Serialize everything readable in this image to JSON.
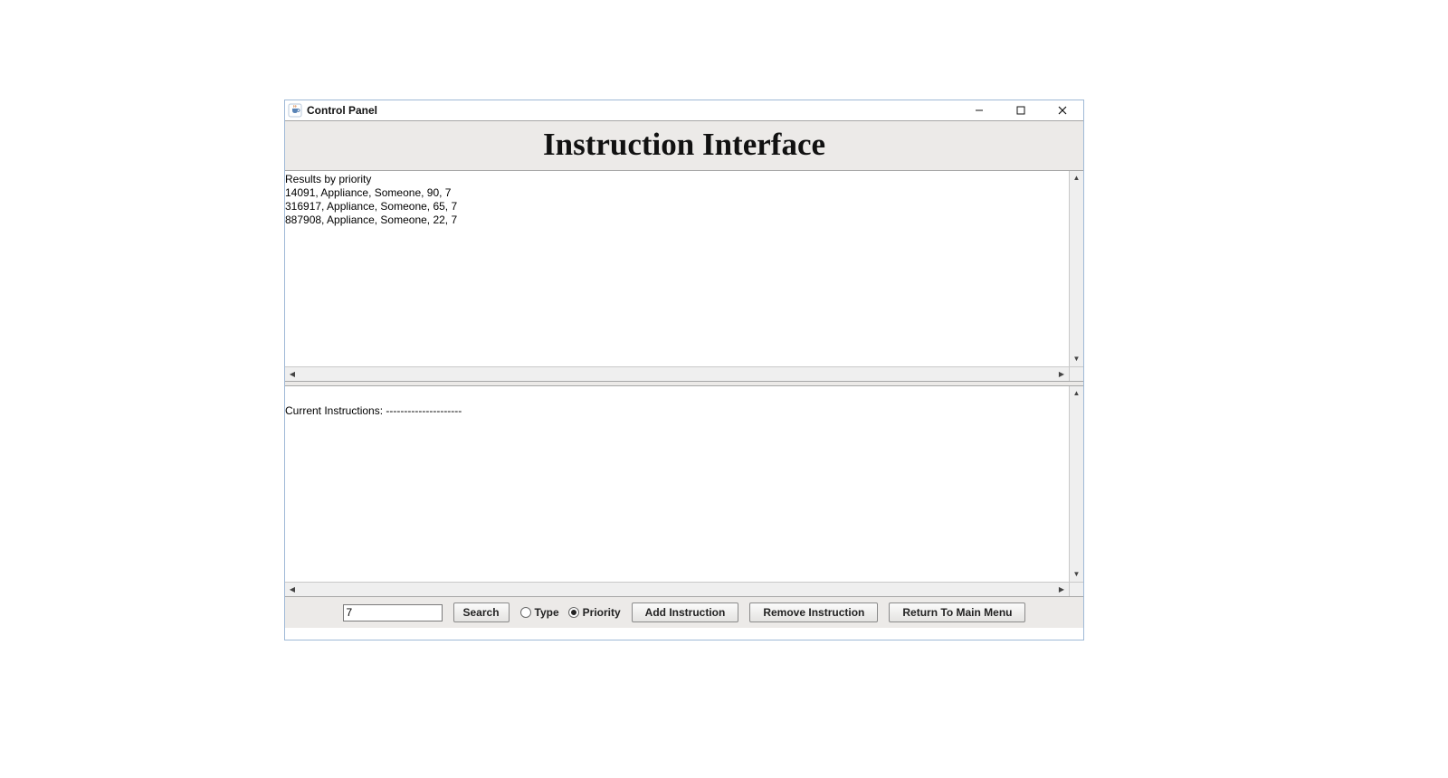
{
  "window": {
    "title": "Control Panel",
    "controls": {
      "minimize": "minimize",
      "maximize": "maximize",
      "close": "close"
    }
  },
  "heading": "Instruction Interface",
  "results_pane": {
    "lines": [
      "Results by priority",
      "14091, Appliance, Someone, 90, 7",
      "316917, Appliance, Someone, 65, 7",
      "887908, Appliance, Someone, 22, 7"
    ]
  },
  "instructions_pane": {
    "text": "Current Instructions: ---------------------"
  },
  "controls": {
    "search_value": "7",
    "search_button": "Search",
    "radios": {
      "type_label": "Type",
      "priority_label": "Priority",
      "selected": "priority"
    },
    "add_button": "Add Instruction",
    "remove_button": "Remove Instruction",
    "return_button": "Return To Main Menu"
  }
}
